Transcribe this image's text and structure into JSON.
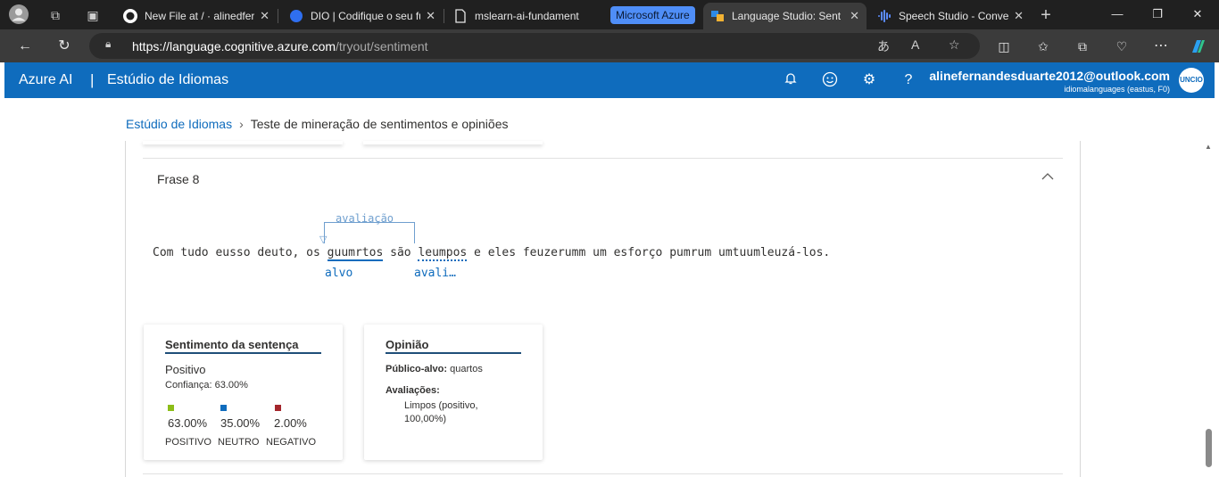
{
  "browser": {
    "tabs": [
      {
        "title": "New File at / · alinedfer",
        "icon": "github-icon"
      },
      {
        "title": "DIO | Codifique o seu fu",
        "icon": "dio-icon"
      },
      {
        "title": "mslearn-ai-fundament",
        "icon": "document-icon"
      },
      {
        "title": "Language Studio: Sent",
        "icon": "language-studio-icon"
      },
      {
        "title": "Speech Studio - Conve",
        "icon": "speech-studio-icon"
      }
    ],
    "group_label": "Microsoft Azure",
    "url_host": "https://language.cognitive.azure.com",
    "url_path": "/tryout/sentiment"
  },
  "header": {
    "brand": "Azure AI",
    "separator": "|",
    "studio": "Estúdio de Idiomas",
    "user_email": "alinefernandesduarte2012@outlook.com",
    "resource": "idiomalanguages (eastus, F0)",
    "avatar_text": "UNCIO"
  },
  "breadcrumb": {
    "link": "Estúdio de Idiomas",
    "current": "Teste de mineração de sentimentos e opiniões"
  },
  "sentence": {
    "title": "Frase 8",
    "text_before": "Com tudo eusso deuto, os ",
    "target_word": "guumrtos",
    "text_middle": " são ",
    "assessment_word": "leumpos",
    "text_after": " e eles feuzerumm um esforço pumrum umtuumleuzá-los.",
    "relation_label": "avaliação",
    "target_tag": "alvo",
    "assessment_tag": "avali…"
  },
  "sentiment_card": {
    "title": "Sentimento da sentença",
    "value": "Positivo",
    "confidence": "Confiança: 63.00%",
    "scores": [
      {
        "pct": "63.00%",
        "label": "POSITIVO",
        "color": "#8cbd18"
      },
      {
        "pct": "35.00%",
        "label": "NEUTRO",
        "color": "#0f6cbd"
      },
      {
        "pct": "2.00%",
        "label": "NEGATIVO",
        "color": "#a4262c"
      }
    ]
  },
  "opinion_card": {
    "title": "Opinião",
    "target_label": "Público-alvo:",
    "target_value": "quartos",
    "assessments_label": "Avaliações:",
    "assessment_value": "Limpos (positivo, 100,00%)"
  }
}
